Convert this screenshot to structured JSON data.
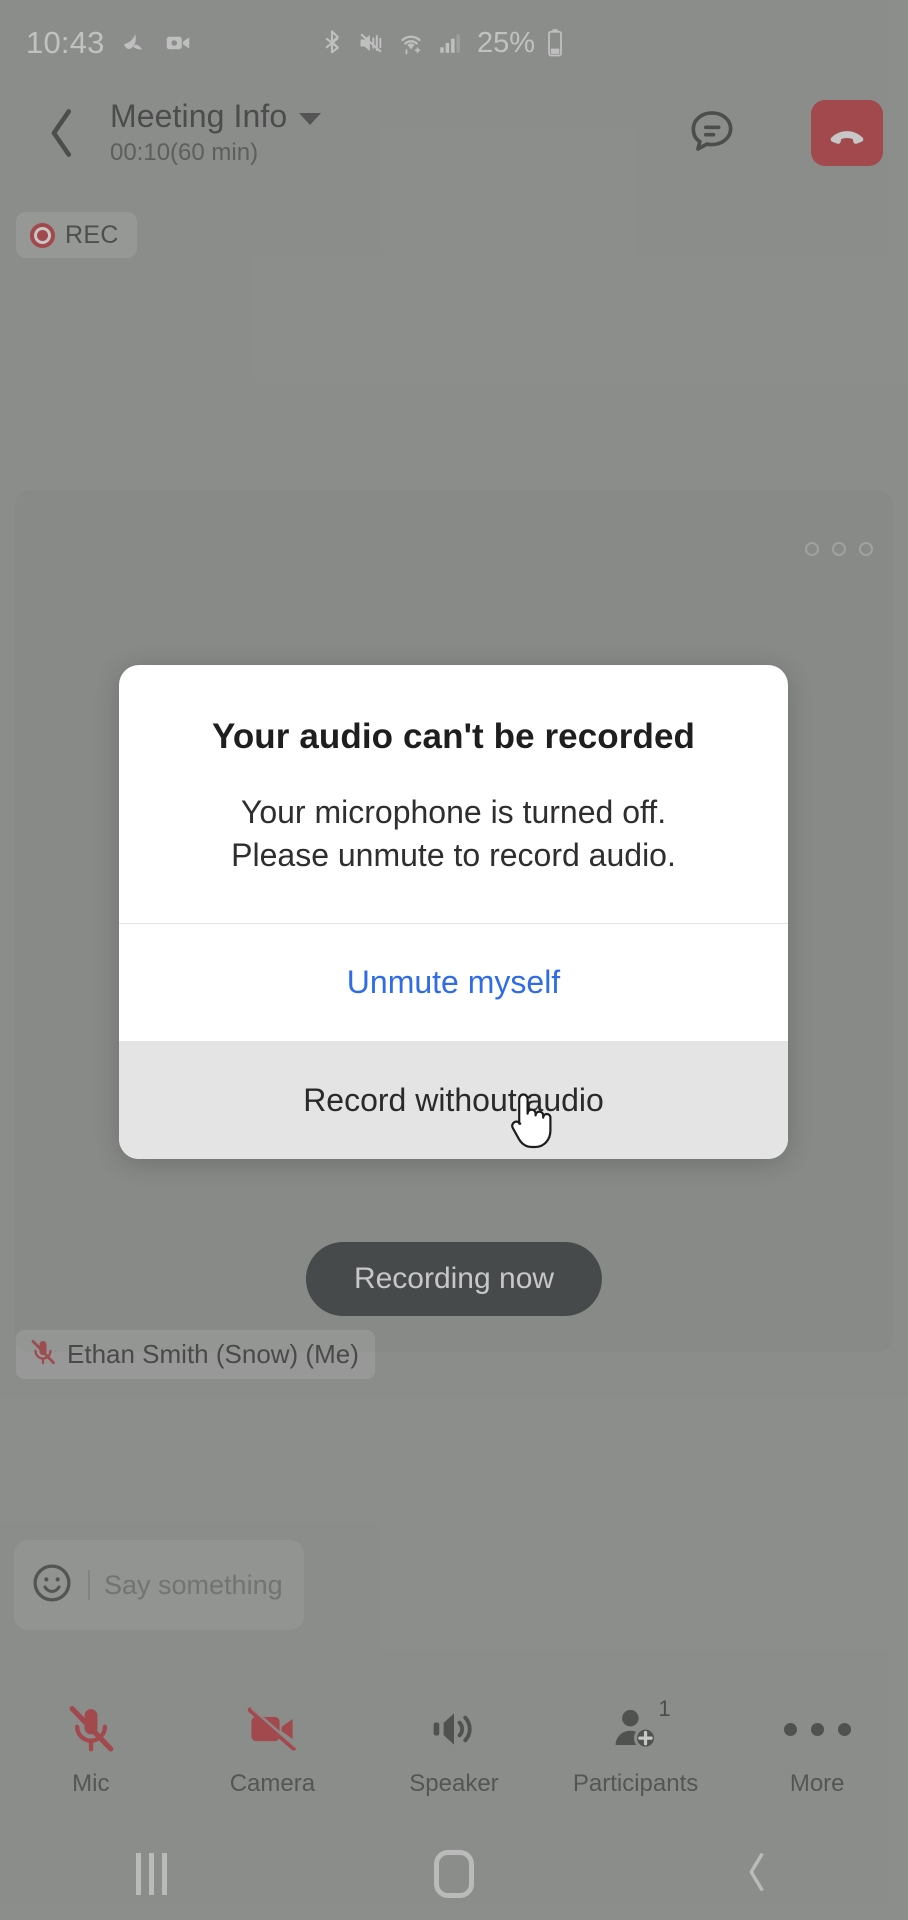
{
  "status_bar": {
    "clock": "10:43",
    "battery_percent": "25%",
    "icons": [
      "notification-icon",
      "video-recorder-icon",
      "bluetooth-icon",
      "sound-vibrate-off-icon",
      "wifi-icon",
      "cellular-signal-icon",
      "battery-icon"
    ]
  },
  "header": {
    "back_label": "Back",
    "title": "Meeting Info",
    "timer": "00:10(60 min)",
    "chat_label": "Chat",
    "end_call_label": "End call"
  },
  "recording": {
    "badge_label": "REC",
    "pill_label": "Recording now",
    "badge_color": "#c0272d"
  },
  "video_tile": {
    "participant_name": "Ethan Smith (Snow) (Me)",
    "mic_state": "muted",
    "loading_dots": 3
  },
  "chat_input": {
    "placeholder": "Say something",
    "emoji_icon": "smiley-icon"
  },
  "toolbar": {
    "items": [
      {
        "label": "Mic",
        "icon": "mic-off-icon",
        "state": "off",
        "color": "#c0272d",
        "badge": ""
      },
      {
        "label": "Camera",
        "icon": "camera-off-icon",
        "state": "off",
        "color": "#c0272d",
        "badge": ""
      },
      {
        "label": "Speaker",
        "icon": "speaker-icon",
        "state": "on",
        "color": "#343634",
        "badge": ""
      },
      {
        "label": "Participants",
        "icon": "add-participant-icon",
        "state": "on",
        "color": "#343634",
        "badge": "1"
      },
      {
        "label": "More",
        "icon": "more-dots-icon",
        "state": "on",
        "color": "#343634",
        "badge": ""
      }
    ]
  },
  "dialog": {
    "title": "Your audio can't be recorded",
    "message_line1": "Your microphone is turned off.",
    "message_line2": "Please unmute to record audio.",
    "primary_action": "Unmute myself",
    "secondary_action": "Record without audio",
    "primary_color": "#2f6ce5"
  },
  "nav_bar": {
    "recents_label": "Recents",
    "home_label": "Home",
    "back_label": "Back"
  }
}
